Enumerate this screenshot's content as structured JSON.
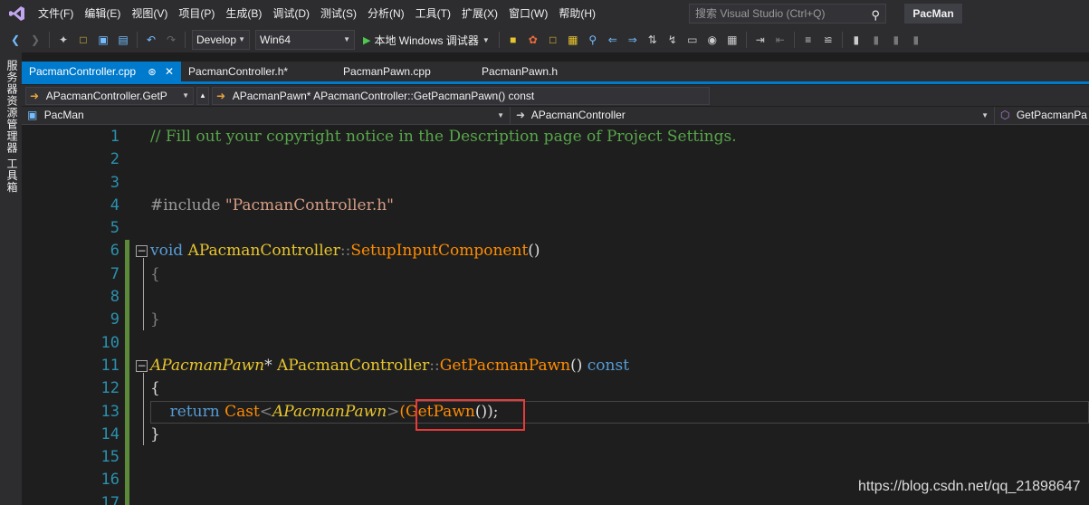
{
  "menubar": {
    "items": [
      "文件(F)",
      "编辑(E)",
      "视图(V)",
      "项目(P)",
      "生成(B)",
      "调试(D)",
      "测试(S)",
      "分析(N)",
      "工具(T)",
      "扩展(X)",
      "窗口(W)",
      "帮助(H)"
    ],
    "search_placeholder": "搜索 Visual Studio (Ctrl+Q)",
    "project_name": "PacMan"
  },
  "toolbar": {
    "config": "Develop",
    "platform": "Win64",
    "run_label": "本地 Windows 调试器"
  },
  "left_rail": {
    "label": "服务器资源管理器 工具箱"
  },
  "tabs": [
    {
      "label": "PacmanController.cpp",
      "active": true
    },
    {
      "label": "PacmanController.h*",
      "active": false
    },
    {
      "label": "PacmanPawn.cpp",
      "active": false
    },
    {
      "label": "PacmanPawn.h",
      "active": false
    }
  ],
  "navbar": {
    "scope_left": "APacmanController.GetP",
    "member": "APacmanPawn* APacmanController::GetPacmanPawn() const"
  },
  "scopebar": {
    "project": "PacMan",
    "class": "APacmanController",
    "function": "GetPacmanPa"
  },
  "editor": {
    "line_numbers": [
      "1",
      "2",
      "3",
      "4",
      "5",
      "6",
      "7",
      "8",
      "9",
      "10",
      "11",
      "12",
      "13",
      "14",
      "15",
      "16",
      "17"
    ],
    "code": {
      "l1": "// Fill out your copyright notice in the Description page of Project Settings.",
      "l4_inc": "#include ",
      "l4_str": "\"PacmanController.h\"",
      "l6_kw": "void",
      "l6_type": "APacmanController",
      "l6_sep": "::",
      "l6_fn": "SetupInputComponent",
      "l6_paren": "()",
      "l7": "{",
      "l9": "}",
      "l11_type": "APacmanPawn",
      "l11_star": "*",
      "l11_cls": "APacmanController",
      "l11_sep": "::",
      "l11_fn": "GetPacmanPawn",
      "l11_paren": "()",
      "l11_kw": "const",
      "l12": "{",
      "l13_kw": "return",
      "l13_fn": "Cast",
      "l13_lt": "<",
      "l13_type": "APacmanPawn",
      "l13_gt": ">",
      "l13_call": "(GetPawn",
      "l13_rest": "());",
      "l14": "}"
    }
  },
  "watermark": "https://blog.csdn.net/qq_21898647",
  "colors": {
    "accent": "#007acc",
    "highlight_box": "#e83a3a",
    "change_bar": "#5c8a3a"
  }
}
